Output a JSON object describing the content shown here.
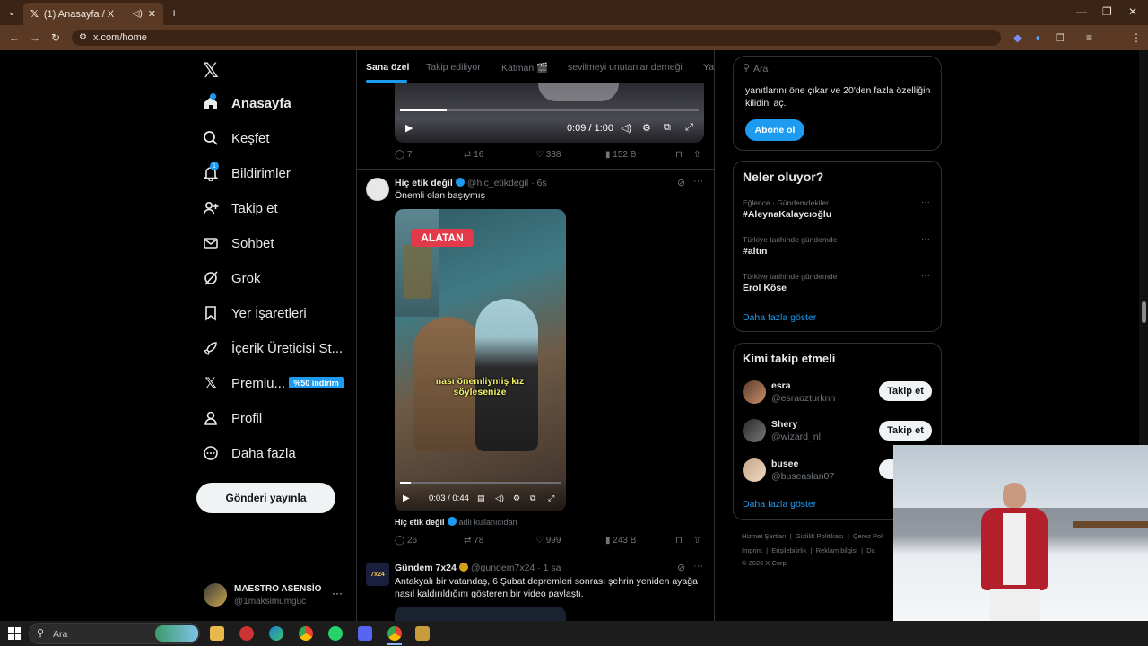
{
  "browser": {
    "tab_title": "(1) Anasayfa / X",
    "url": "x.com/home"
  },
  "nav": {
    "items": [
      "Anasayfa",
      "Keşfet",
      "Bildirimler",
      "Takip et",
      "Sohbet",
      "Grok",
      "Yer İşaretleri",
      "İçerik Üreticisi St...",
      "Premiu...",
      "Profil",
      "Daha fazla"
    ],
    "premium_badge": "%50 indirim",
    "post_button": "Gönderi yayınla",
    "account_name": "MAESTRO ASENSİO",
    "account_handle": "@1maksimumguc"
  },
  "tabs": [
    "Sana özel",
    "Takip ediliyor",
    "Katman 🎬",
    "sevilmeyi unutanlar derneği",
    "Ya"
  ],
  "video1": {
    "time": "0:09 / 1:00",
    "replies": "7",
    "reposts": "16",
    "likes": "338",
    "views": "152 B"
  },
  "tweet2": {
    "name": "Hiç etik değil",
    "handle": "@hic_etikdegil",
    "time": "6s",
    "text": "Önemli olan başıymış",
    "overlay_brand": "ALATAN",
    "caption": "nası önemliymiş kız söylesenize",
    "video_time": "0:03 / 0:44",
    "attribution_name": "Hiç etik değil",
    "attribution_suffix": "adlı kullanıcıdan",
    "replies": "26",
    "reposts": "78",
    "likes": "999",
    "views": "243 B"
  },
  "tweet3": {
    "avatar_text": "7x24",
    "name": "Gündem 7x24",
    "handle": "@gundem7x24",
    "time": "1 sa",
    "text_line1": "Antakyalı bir vatandaş, 6 Şubat depremleri sonrası şehrin yeniden ayağa",
    "text_line2": "nasıl kaldırıldığını gösteren bir video paylaştı."
  },
  "right": {
    "search_placeholder": "Ara",
    "premium_text_line1": "yanıtlarını öne çıkar ve 20'den fazla özelliğin",
    "premium_text_line2": "kilidini aç.",
    "subscribe_button": "Abone ol",
    "trends_title": "Neler oluyor?",
    "trends": [
      {
        "context": "Eğlence · Gündemdekiler",
        "topic": "#AleynaKalaycıoğlu"
      },
      {
        "context": "Türkiye tarihinde gündemde",
        "topic": "#altın"
      },
      {
        "context": "Türkiye tarihinde gündemde",
        "topic": "Erol Köse"
      }
    ],
    "show_more": "Daha fazla göster",
    "who_to_follow_title": "Kimi takip etmeli",
    "suggestions": [
      {
        "name": "esra",
        "handle": "@esraozturknn",
        "button": "Takip et"
      },
      {
        "name": "Shery",
        "handle": "@wizard_nl",
        "button": "Takip et"
      },
      {
        "name": "busee",
        "handle": "@buseaslan07",
        "button": "T"
      }
    ],
    "footer_line1": [
      "Hizmet Şartları",
      "Gizlilik Politikası",
      "Çerez Poli"
    ],
    "footer_line2": [
      "Imprint",
      "Erişilebilirlik",
      "Reklam bilgisi",
      "Da"
    ],
    "copyright": "© 2026 X Corp."
  },
  "taskbar": {
    "search_placeholder": "Ara"
  },
  "colors": {
    "accent": "#1d9bf0",
    "browser_frame": "#5a3a24",
    "background": "#000000"
  }
}
